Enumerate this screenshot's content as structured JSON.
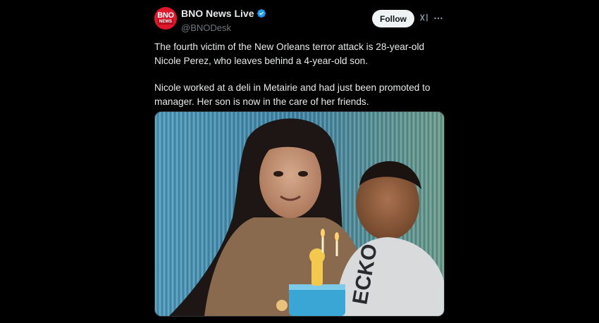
{
  "account": {
    "display_name": "BNO News Live",
    "handle": "@BNODesk",
    "avatar_line1": "BNO",
    "avatar_line2": "NEWS"
  },
  "actions": {
    "follow_label": "Follow",
    "grok_icon": "grok-icon",
    "more_icon": "more-horizontal-icon"
  },
  "post": {
    "paragraph1": "The fourth victim of the New Orleans terror attack is 28-year-old Nicole Perez, who leaves behind a 4-year-old son.",
    "paragraph2": "Nicole worked at a deli in Metairie and had just been promoted to manager. Her son is now in the care of her friends."
  },
  "colors": {
    "background": "#000000",
    "text": "#e7e9ea",
    "muted": "#71767b",
    "verified": "#1d9bf0",
    "brand_red": "#e0162b"
  }
}
